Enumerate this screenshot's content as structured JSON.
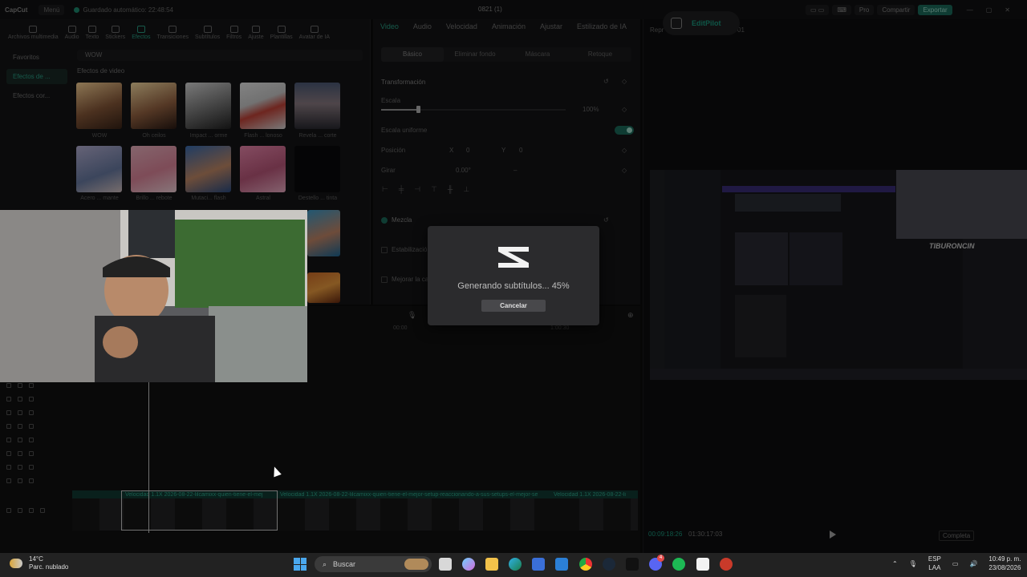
{
  "app": {
    "logo": "CapCut",
    "menu": "Menú",
    "autosave": "Guardado automático: 22:48:54",
    "project_title": "0821 (1)",
    "pro_label": "Pro",
    "share_label": "Compartir",
    "export_label": "Exportar"
  },
  "toolbar": {
    "tabs": [
      "Archivos multimedia",
      "Audio",
      "Texto",
      "Stickers",
      "Efectos",
      "Transiciones",
      "Subtítulos",
      "Filtros",
      "Ajuste",
      "Plantillas",
      "Avatar de IA"
    ],
    "active_tab": "Efectos"
  },
  "effects_panel": {
    "categories": [
      "Favoritos",
      "Efectos de ...",
      "Efectos cor..."
    ],
    "search_value": "WOW",
    "section_title": "Efectos de video",
    "items": [
      "WOW",
      "Oh ceilos",
      "Impact ... orme",
      "Flash ... lonoso",
      "Revela ... corte",
      "Acero ... mante",
      "Brillo ... rebote",
      "Mutaci... flash",
      "Astral",
      "Destello ... tinta"
    ]
  },
  "properties": {
    "tabs": [
      "Video",
      "Audio",
      "Velocidad",
      "Animación",
      "Ajustar",
      "Estilizado de IA"
    ],
    "active_tab": "Video",
    "subtabs": [
      "Básico",
      "Eliminar fondo",
      "Máscara",
      "Retoque"
    ],
    "active_subtab": "Básico",
    "transform_label": "Transformación",
    "scale_label": "Escala",
    "scale_value": "100%",
    "uniform_scale_label": "Escala uniforme",
    "position_label": "Posición",
    "pos_x_label": "X",
    "pos_x": "0",
    "pos_y_label": "Y",
    "pos_y": "0",
    "rotate_label": "Girar",
    "rotate_value": "0.00°",
    "rotate_dash": "–",
    "blend_label": "Mezcla",
    "stabilize_label": "Estabilización",
    "enhance_label": "Mejorar la cal"
  },
  "player": {
    "tab_label_left": "Repr",
    "tab_label_right": "01",
    "editpilot": "EditPilot",
    "current_time": "00:09:18:26",
    "total_time": "01:30:17:03",
    "fullscreen_label": "Completa",
    "stream_brand": "TIBURONCIN"
  },
  "timeline": {
    "ruler": [
      "00:00",
      "1:00:30"
    ],
    "clips": [
      "Velocidad 1.1X   2026-08-22-lilcamixx-quien-tiene-el-mej",
      "Velocidad 1.1X   2026-08-22-lilcamixx-quien-tiene-el-mejor-setup-reaccionando-a-sus-setups-el-mejor-se",
      "Velocidad 1.1X   2026-08-22-li"
    ]
  },
  "modal": {
    "message": "Generando subtítulos... 45%",
    "progress_percent": 45,
    "cancel_label": "Cancelar"
  },
  "taskbar": {
    "temperature": "14°C",
    "weather": "Parc. nublado",
    "search_label": "Buscar",
    "language": "ESP",
    "keyboard": "LAA",
    "time": "10:49 p. m.",
    "date": "23/08/2026",
    "badge_discord": "4"
  },
  "colors": {
    "accent": "#2aa489",
    "export_bg": "#1d6e5d",
    "panel": "#141416",
    "modal_bg": "#2b2b2d"
  }
}
